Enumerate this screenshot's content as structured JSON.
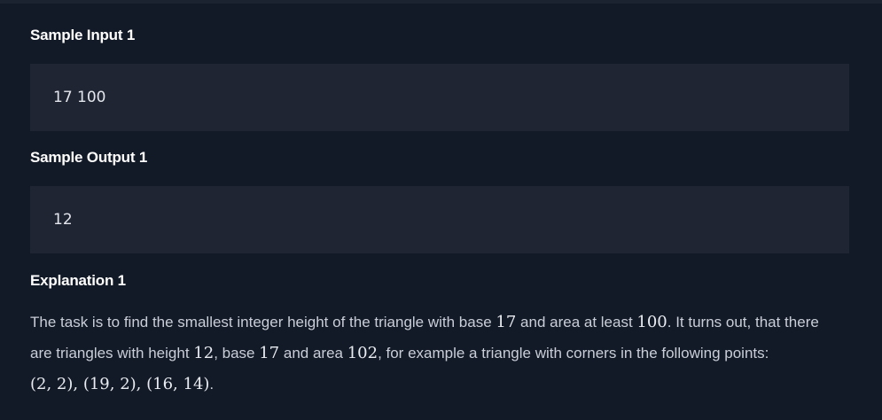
{
  "samples": [
    {
      "input_heading": "Sample Input 1",
      "input": "17 100",
      "output_heading": "Sample Output 1",
      "output": "12"
    }
  ],
  "explanation": {
    "heading": "Explanation 1",
    "line1": {
      "t1": "The task is to find the smallest integer height of the triangle with base ",
      "m1": "17",
      "t2": " and area at least ",
      "m2": "100",
      "t3": ". It turns out, that there"
    },
    "line2": {
      "t1": "are triangles with height ",
      "m1": "12",
      "t2": ", base ",
      "m2": "17",
      "t3": " and area ",
      "m3": "102",
      "t4": ", for example a triangle with corners in the following points:"
    },
    "line3": {
      "m1": "(2, 2), (19, 2), (16, 14)",
      "t1": "."
    }
  }
}
